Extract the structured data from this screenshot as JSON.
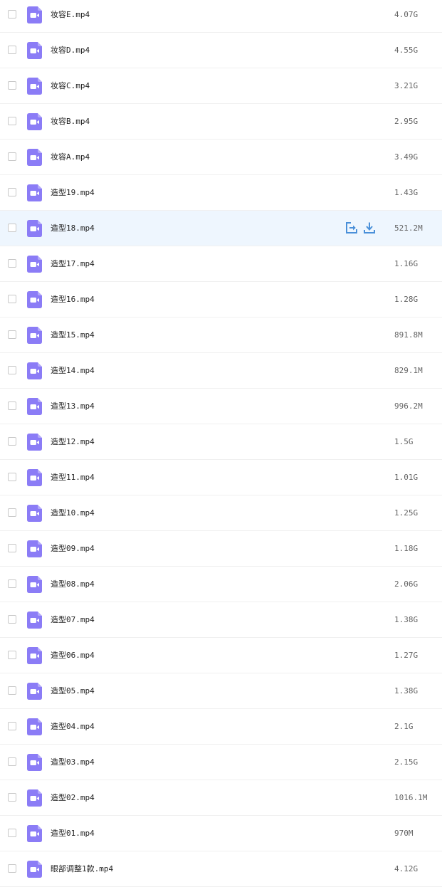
{
  "colors": {
    "icon_bg": "#8b7cf6",
    "hover_bg": "#eef6fe",
    "action": "#4a90d9"
  },
  "icons": {
    "file": "video-file-icon",
    "share": "share-icon",
    "download": "download-icon"
  },
  "hovered_index": 6,
  "files": [
    {
      "name": "妆容E.mp4",
      "size": "4.07G"
    },
    {
      "name": "妆容D.mp4",
      "size": "4.55G"
    },
    {
      "name": "妆容C.mp4",
      "size": "3.21G"
    },
    {
      "name": "妆容B.mp4",
      "size": "2.95G"
    },
    {
      "name": "妆容A.mp4",
      "size": "3.49G"
    },
    {
      "name": "造型19.mp4",
      "size": "1.43G"
    },
    {
      "name": "造型18.mp4",
      "size": "521.2M"
    },
    {
      "name": "造型17.mp4",
      "size": "1.16G"
    },
    {
      "name": "造型16.mp4",
      "size": "1.28G"
    },
    {
      "name": "造型15.mp4",
      "size": "891.8M"
    },
    {
      "name": "造型14.mp4",
      "size": "829.1M"
    },
    {
      "name": "造型13.mp4",
      "size": "996.2M"
    },
    {
      "name": "造型12.mp4",
      "size": "1.5G"
    },
    {
      "name": "造型11.mp4",
      "size": "1.01G"
    },
    {
      "name": "造型10.mp4",
      "size": "1.25G"
    },
    {
      "name": "造型09.mp4",
      "size": "1.18G"
    },
    {
      "name": "造型08.mp4",
      "size": "2.06G"
    },
    {
      "name": "造型07.mp4",
      "size": "1.38G"
    },
    {
      "name": "造型06.mp4",
      "size": "1.27G"
    },
    {
      "name": "造型05.mp4",
      "size": "1.38G"
    },
    {
      "name": "造型04.mp4",
      "size": "2.1G"
    },
    {
      "name": "造型03.mp4",
      "size": "2.15G"
    },
    {
      "name": "造型02.mp4",
      "size": "1016.1M"
    },
    {
      "name": "造型01.mp4",
      "size": "970M"
    },
    {
      "name": "眼部调整1款.mp4",
      "size": "4.12G"
    }
  ]
}
